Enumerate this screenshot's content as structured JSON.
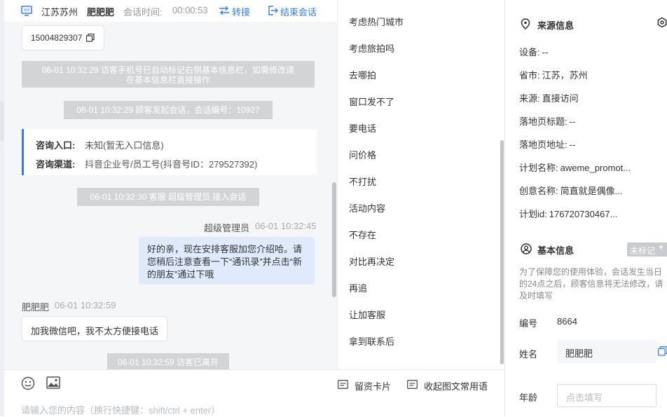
{
  "header": {
    "location": "江苏苏州",
    "visitor_name": "肥肥肥",
    "session_time_label": "会话时间:",
    "session_time": "00:00:53",
    "transfer_label": "转接",
    "end_label": "结束会话"
  },
  "chat": {
    "phone": "15004829307",
    "sys_phone_notice_1": "06-01 10:32:29 访客手机号已自动标记右侧基本信息栏，如需修改请",
    "sys_phone_notice_2": "在基本信息栏直接操作",
    "sys_session_start": "06-01 10:32:29 顾客发起会话，会话编号：10927",
    "entry_label": "咨询入口:",
    "entry_value": "未知(暂无入口信息)",
    "channel_label": "咨询渠道:",
    "channel_value": "抖音企业号/员工号(抖音号ID：279527392)",
    "sys_agent_join": "06-01 10:32:30 客服 超级管理员 接入会话",
    "agent_name": "超级管理员",
    "agent_time": "06-01 10:32:45",
    "agent_msg_line1": "好的亲，现在安排客服加您介绍哈。请",
    "agent_msg_line2": "您稍后注意查看一下“通讯录”并点击“新",
    "agent_msg_line3": "的朋友”通过下哦",
    "visitor_name": "肥肥肥",
    "visitor_time": "06-01 10:32:59",
    "visitor_msg": "加我微信吧，我不太方便接电话",
    "sys_left": "06-01 10:32:59 访客已离开"
  },
  "quick_replies": [
    "考虑热门城市",
    "考虑旅拍吗",
    "去哪拍",
    "窗口发不了",
    "要电话",
    "问价格",
    "不打扰",
    "活动内容",
    "不存在",
    "对比再决定",
    "再追",
    "让加客服",
    "拿到联系后"
  ],
  "input": {
    "placeholder": "请输入您的内容（换行快捷键：shift/ctrl + enter）",
    "card_label": "留资卡片",
    "collapse_label": "收起图文常用语"
  },
  "source": {
    "title": "来源信息",
    "rows": [
      {
        "label": "设备:",
        "value": "--"
      },
      {
        "label": "省市:",
        "value": "江苏，苏州"
      },
      {
        "label": "来源:",
        "value": "直接访问"
      },
      {
        "label": "落地页标题:",
        "value": "--"
      },
      {
        "label": "落地页地址:",
        "value": "--"
      },
      {
        "label": "计划名称:",
        "value": "aweme_promot..."
      },
      {
        "label": "创意名称:",
        "value": "简直就是偶像..."
      },
      {
        "label": "计划id:",
        "value": "176720730467..."
      }
    ]
  },
  "basic": {
    "title": "基本信息",
    "tag_button": "未标记",
    "notice_line1": "为了保障您的使用体验，会话发生当日",
    "notice_line2": "的24点之后，顾客信息将无法修改，请",
    "notice_line3": "及时填写",
    "id_label": "编号",
    "id_value": "8664",
    "name_label": "姓名",
    "name_value": "肥肥肥",
    "age_label": "年龄",
    "age_placeholder": "点击填写"
  },
  "colors": {
    "accent": "#2f7cf6",
    "system_bg": "#d3d4d6",
    "agent_bubble": "#dfeafc",
    "entry_bar": "#2f7cf6"
  }
}
